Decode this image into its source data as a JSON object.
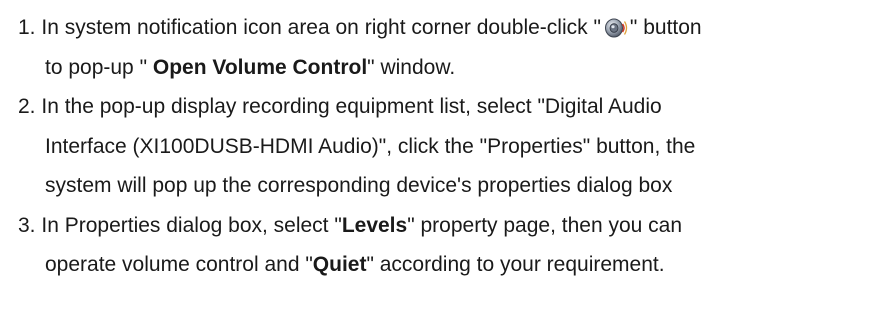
{
  "steps": [
    {
      "number": "1.",
      "lines": [
        {
          "pre": "In system notification icon area on right corner double-click \"",
          "icon": "speaker-icon",
          "post": "\" button"
        },
        {
          "pre": "to pop-up \" ",
          "bold": "Open Volume Control",
          "post": "\" window."
        }
      ]
    },
    {
      "number": "2.",
      "lines": [
        {
          "text": "In the pop-up display recording equipment list, select \"Digital Audio"
        },
        {
          "text": "Interface (XI100DUSB-HDMI Audio)\", click the \"Properties\" button, the"
        },
        {
          "text": "system will pop up the corresponding device's properties dialog box"
        }
      ]
    },
    {
      "number": "3.",
      "lines": [
        {
          "pre": "In Properties dialog box, select \"",
          "bold": "Levels",
          "post": "\" property page, then you can"
        },
        {
          "pre": "operate volume control and \"",
          "bold": "Quiet",
          "post": "\" according to your requirement."
        }
      ]
    }
  ]
}
